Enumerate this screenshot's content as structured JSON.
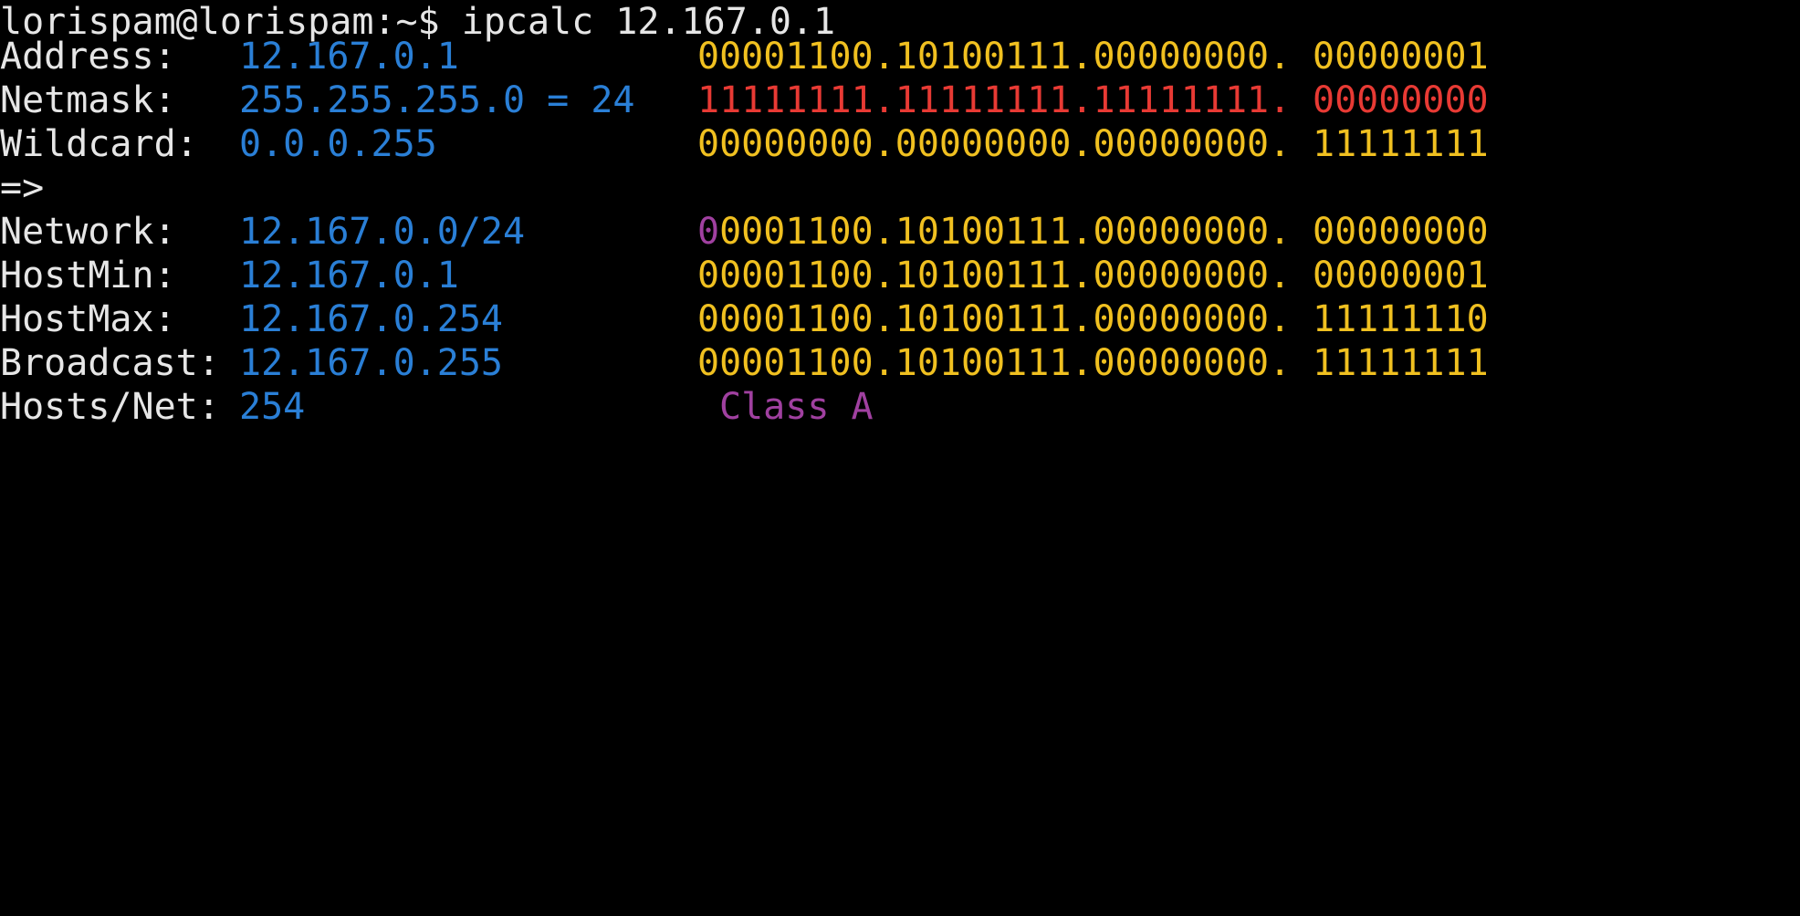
{
  "terminal": {
    "prompt": "lorispam@lorispam:~$ ipcalc 12.167.0.1",
    "colors": {
      "background": "#000000",
      "text": "#e6e6e6",
      "value": "#2a7fd6",
      "binary": "#f0c020",
      "netmask_binary": "#e83a34",
      "class_bit": "#a040a0"
    },
    "rows": {
      "address": {
        "label": "Address:",
        "value": "12.167.0.1",
        "bin_net": "00001100.10100111.00000000.",
        "bin_host": "00000001"
      },
      "netmask": {
        "label": "Netmask:",
        "value": "255.255.255.0 = 24",
        "bin_net": "11111111.11111111.11111111.",
        "bin_host": "00000000"
      },
      "wildcard": {
        "label": "Wildcard:",
        "value": "0.0.0.255",
        "bin_net": "00000000.00000000.00000000.",
        "bin_host": "11111111"
      },
      "arrow": "=>",
      "network": {
        "label": "Network:",
        "value": "12.167.0.0/24",
        "bin_class_bit": "0",
        "bin_net_rest": "0001100.10100111.00000000.",
        "bin_host": "00000000"
      },
      "hostmin": {
        "label": "HostMin:",
        "value": "12.167.0.1",
        "bin_net": "00001100.10100111.00000000.",
        "bin_host": "00000001"
      },
      "hostmax": {
        "label": "HostMax:",
        "value": "12.167.0.254",
        "bin_net": "00001100.10100111.00000000.",
        "bin_host": "11111110"
      },
      "broadcast": {
        "label": "Broadcast:",
        "value": "12.167.0.255",
        "bin_net": "00001100.10100111.00000000.",
        "bin_host": "11111111"
      },
      "hosts": {
        "label": "Hosts/Net:",
        "value": "254",
        "class": "Class A"
      }
    }
  }
}
